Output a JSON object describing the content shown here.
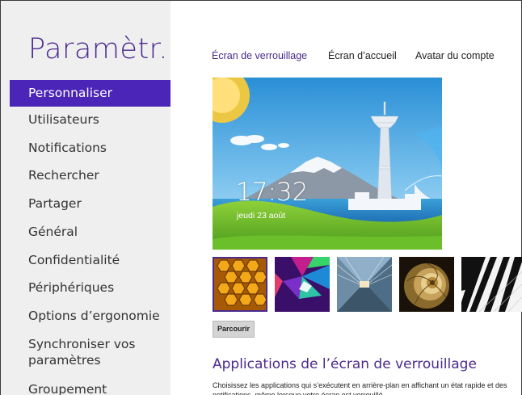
{
  "sidebar": {
    "title": "Paramètr...",
    "items": [
      {
        "label": "Personnaliser",
        "selected": true
      },
      {
        "label": "Utilisateurs"
      },
      {
        "label": "Notifications"
      },
      {
        "label": "Rechercher"
      },
      {
        "label": "Partager"
      },
      {
        "label": "Général"
      },
      {
        "label": "Confidentialité"
      },
      {
        "label": "Périphériques"
      },
      {
        "label": "Options d’ergonomie"
      },
      {
        "label": "Synchroniser vos",
        "label2": "paramètres"
      },
      {
        "label": "Groupement"
      }
    ]
  },
  "tabs": [
    {
      "label": "Écran de verrouillage",
      "active": true
    },
    {
      "label": "Écran d’accueil"
    },
    {
      "label": "Avatar du compte"
    }
  ],
  "lock_preview": {
    "time": "17:32",
    "date": "jeudi 23 août"
  },
  "thumbnails": [
    {
      "name": "honeycomb",
      "selected": true
    },
    {
      "name": "colorful-geometric"
    },
    {
      "name": "tunnel"
    },
    {
      "name": "nautilus-shell"
    },
    {
      "name": "piano-keys"
    }
  ],
  "browse_button": "Parcourir",
  "apps_section": {
    "heading": "Applications de l’écran de verrouillage",
    "description": "Choisissez les applications qui s’exécutent en arrière-plan en affichant un état rapide et des notifications, même lorsque votre écran est verrouillé."
  },
  "colors": {
    "accent": "#4b24b8",
    "title": "#4b2a8e",
    "sidebar_bg": "#efefef"
  }
}
